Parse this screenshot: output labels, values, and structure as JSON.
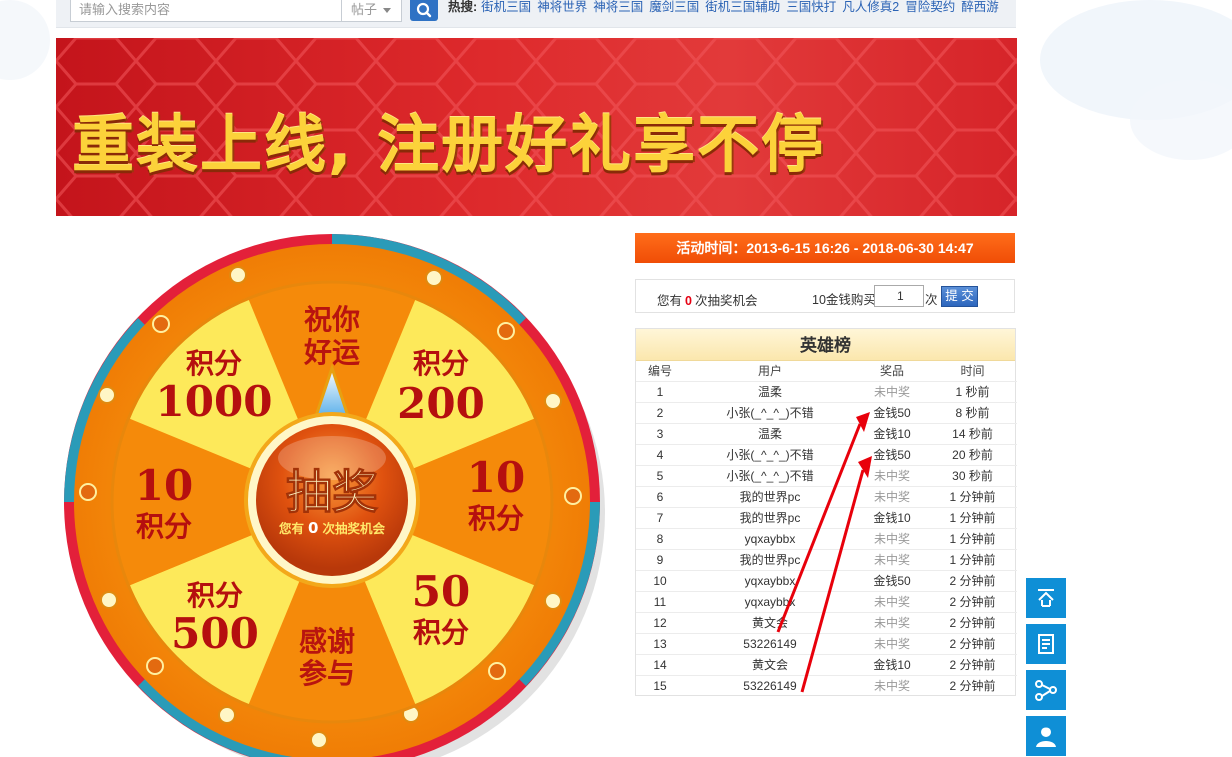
{
  "search": {
    "placeholder": "请输入搜索内容",
    "type": "帖子"
  },
  "hot": {
    "label": "热搜:",
    "items": [
      "街机三国",
      "神将世界",
      "神将三国",
      "魔剑三国",
      "街机三国辅助",
      "三国快打",
      "凡人修真2",
      "冒险契约",
      "醉西游"
    ]
  },
  "banner": {
    "text": "重装上线, 注册好礼享不停"
  },
  "wheel": {
    "center_label": "抽奖",
    "center_sub_prefix": "您有",
    "center_sub_count": "0",
    "center_sub_suffix": "次抽奖机会",
    "segments": [
      {
        "top": "祝你",
        "bottom": "好运"
      },
      {
        "top": "积分",
        "bottom": "200"
      },
      {
        "top": "10",
        "bottom": "积分"
      },
      {
        "top": "50",
        "bottom": "积分"
      },
      {
        "top": "感谢",
        "bottom": "参与"
      },
      {
        "top": "积分",
        "bottom": "500"
      },
      {
        "top": "10",
        "bottom": "积分"
      },
      {
        "top": "积分",
        "bottom": "1000"
      }
    ]
  },
  "activity": {
    "time_text": "活动时间：2013-6-15 16:26 - 2018-06-30 14:47"
  },
  "buy": {
    "chance_prefix": "您有",
    "chance_count": "0",
    "chance_suffix": "次抽奖机会",
    "buy_label": "10金钱购买",
    "qty": "1",
    "unit": "次",
    "submit": "提 交"
  },
  "ranking": {
    "title": "英雄榜",
    "columns": [
      "编号",
      "用户",
      "奖品",
      "时间"
    ],
    "rows": [
      {
        "no": "1",
        "user": "温柔",
        "prize": "未中奖",
        "time": "1 秒前",
        "won": false
      },
      {
        "no": "2",
        "user": "小张(_^_^_)不错",
        "prize": "金钱50",
        "time": "8 秒前",
        "won": true
      },
      {
        "no": "3",
        "user": "温柔",
        "prize": "金钱10",
        "time": "14 秒前",
        "won": true
      },
      {
        "no": "4",
        "user": "小张(_^_^_)不错",
        "prize": "金钱50",
        "time": "20 秒前",
        "won": true
      },
      {
        "no": "5",
        "user": "小张(_^_^_)不错",
        "prize": "未中奖",
        "time": "30 秒前",
        "won": false
      },
      {
        "no": "6",
        "user": "我的世界pc",
        "prize": "未中奖",
        "time": "1 分钟前",
        "won": false
      },
      {
        "no": "7",
        "user": "我的世界pc",
        "prize": "金钱10",
        "time": "1 分钟前",
        "won": true
      },
      {
        "no": "8",
        "user": "yqxaybbx",
        "prize": "未中奖",
        "time": "1 分钟前",
        "won": false
      },
      {
        "no": "9",
        "user": "我的世界pc",
        "prize": "未中奖",
        "time": "1 分钟前",
        "won": false
      },
      {
        "no": "10",
        "user": "yqxaybbx",
        "prize": "金钱50",
        "time": "2 分钟前",
        "won": true
      },
      {
        "no": "11",
        "user": "yqxaybbx",
        "prize": "未中奖",
        "time": "2 分钟前",
        "won": false
      },
      {
        "no": "12",
        "user": "黄文会",
        "prize": "未中奖",
        "time": "2 分钟前",
        "won": false
      },
      {
        "no": "13",
        "user": "53226149",
        "prize": "未中奖",
        "time": "2 分钟前",
        "won": false
      },
      {
        "no": "14",
        "user": "黄文会",
        "prize": "金钱10",
        "time": "2 分钟前",
        "won": true
      },
      {
        "no": "15",
        "user": "53226149",
        "prize": "未中奖",
        "time": "2 分钟前",
        "won": false
      }
    ]
  },
  "sidebar": {
    "icons": [
      "back-to-top-icon",
      "document-icon",
      "share-icon",
      "customer-service-icon"
    ]
  },
  "colors": {
    "accent_orange": "#f04d06",
    "link_blue": "#2b63b5",
    "side_blue": "#0f8fd6",
    "won_red": "#e60012"
  }
}
